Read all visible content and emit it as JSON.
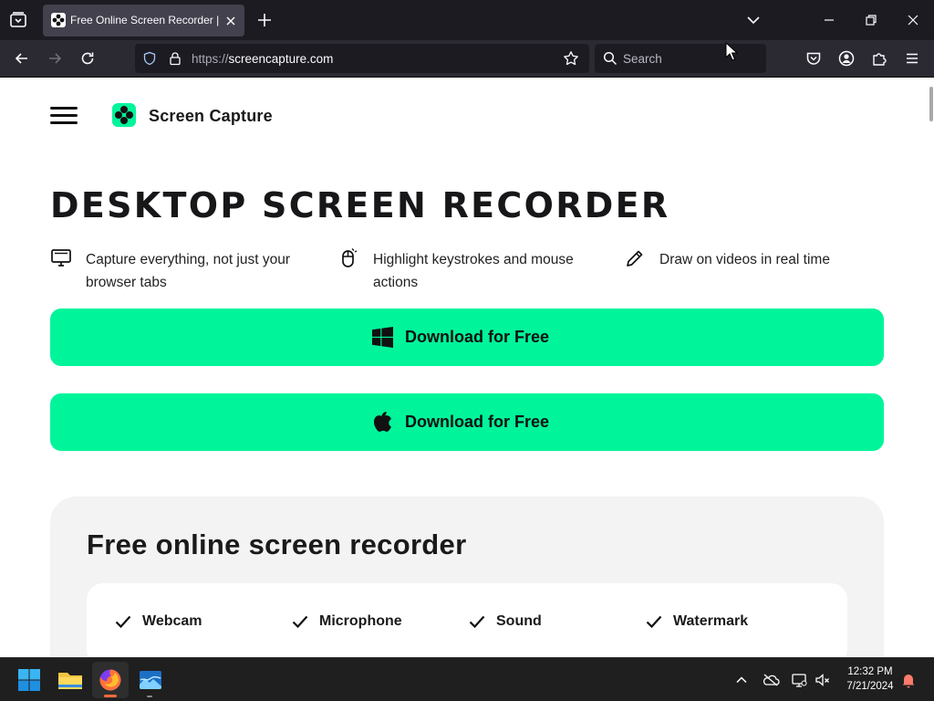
{
  "browser": {
    "tab": {
      "title": "Free Online Screen Recorder | O"
    },
    "url": {
      "scheme": "https://",
      "host": "screencapture.com"
    },
    "search_placeholder": "Search"
  },
  "site": {
    "brand": "Screen Capture",
    "hero_title": "DESKTOP SCREEN RECORDER",
    "features": [
      {
        "icon": "monitor-icon",
        "text": "Capture everything, not just your browser tabs"
      },
      {
        "icon": "mouse-icon",
        "text": "Highlight keystrokes and mouse actions"
      },
      {
        "icon": "pencil-icon",
        "text": "Draw on videos in real time"
      }
    ],
    "download_buttons": [
      {
        "icon": "windows-icon",
        "label": "Download for Free"
      },
      {
        "icon": "apple-icon",
        "label": "Download for Free"
      }
    ],
    "card": {
      "title": "Free online screen recorder",
      "checks": [
        "Webcam",
        "Microphone",
        "Sound",
        "Watermark"
      ]
    },
    "colors": {
      "accent": "#00f59b",
      "card_bg": "#f3f3f3"
    }
  },
  "taskbar": {
    "time": "12:32 PM",
    "date": "7/21/2024"
  }
}
